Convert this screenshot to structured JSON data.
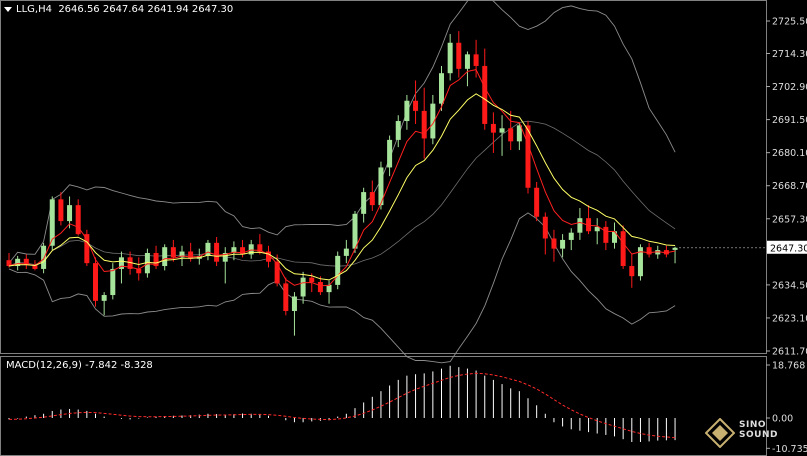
{
  "header": {
    "symbol": "LLG,H4",
    "ohlc": "2646.56 2647.64 2641.94 2647.30"
  },
  "macd": {
    "label": "MACD(12,26,9)",
    "values": "-7.842 -8.328",
    "axis_labels": [
      "18.768",
      "0.00",
      "-10.735"
    ]
  },
  "price_axis_labels": [
    "2725.50",
    "2714.30",
    "2702.90",
    "2691.50",
    "2680.10",
    "2668.70",
    "2657.30",
    "2634.50",
    "2623.10",
    "2611.70"
  ],
  "current_price": "2647.30",
  "logo_text": "SINO SOUND",
  "colors": {
    "background": "#000000",
    "up_candle": "#a6e39b",
    "down_candle": "#ff1a1a",
    "fast_ma": "#ff2020",
    "slow_ma": "#ffff66",
    "bollinger": "#8c8c8c",
    "macd_hist": "#ffffff",
    "macd_signal": "#ff2a2a"
  },
  "chart_data": {
    "type": "candlestick",
    "symbol": "LLG",
    "timeframe": "H4",
    "y_range": [
      2608,
      2730
    ],
    "candles": [
      [
        2643.0,
        2645.5,
        2640.5,
        2641.0
      ],
      [
        2641.0,
        2644.5,
        2639.5,
        2643.5
      ],
      [
        2643.5,
        2645.0,
        2640.0,
        2641.5
      ],
      [
        2641.5,
        2643.0,
        2639.5,
        2640.0
      ],
      [
        2640.0,
        2649.0,
        2638.5,
        2648.0
      ],
      [
        2648.0,
        2665.0,
        2646.5,
        2664.0
      ],
      [
        2664.0,
        2666.5,
        2655.0,
        2656.5
      ],
      [
        2656.5,
        2665.0,
        2654.0,
        2662.0
      ],
      [
        2662.0,
        2664.0,
        2651.5,
        2652.0
      ],
      [
        2652.0,
        2653.5,
        2641.0,
        2642.0
      ],
      [
        2642.0,
        2644.0,
        2627.0,
        2629.0
      ],
      [
        2629.0,
        2632.0,
        2624.0,
        2631.0
      ],
      [
        2631.0,
        2642.0,
        2629.5,
        2640.0
      ],
      [
        2640.0,
        2646.0,
        2635.0,
        2644.0
      ],
      [
        2644.0,
        2646.0,
        2638.0,
        2640.0
      ],
      [
        2640.0,
        2644.0,
        2636.0,
        2638.5
      ],
      [
        2638.5,
        2647.0,
        2637.0,
        2645.5
      ],
      [
        2645.5,
        2648.0,
        2640.0,
        2641.0
      ],
      [
        2641.0,
        2648.5,
        2639.5,
        2647.5
      ],
      [
        2647.5,
        2650.0,
        2642.5,
        2644.0
      ],
      [
        2644.0,
        2648.0,
        2641.0,
        2646.0
      ],
      [
        2646.0,
        2649.0,
        2642.5,
        2643.5
      ],
      [
        2643.5,
        2647.0,
        2641.5,
        2644.5
      ],
      [
        2644.5,
        2650.0,
        2643.0,
        2649.0
      ],
      [
        2649.0,
        2651.0,
        2641.0,
        2642.5
      ],
      [
        2642.5,
        2647.5,
        2635.0,
        2645.5
      ],
      [
        2645.5,
        2649.5,
        2643.0,
        2647.5
      ],
      [
        2647.5,
        2650.0,
        2644.0,
        2645.0
      ],
      [
        2645.0,
        2650.0,
        2643.5,
        2648.5
      ],
      [
        2648.5,
        2652.0,
        2645.0,
        2646.0
      ],
      [
        2646.0,
        2648.0,
        2640.5,
        2642.5
      ],
      [
        2642.5,
        2645.0,
        2634.0,
        2635.0
      ],
      [
        2635.0,
        2637.0,
        2624.0,
        2625.5
      ],
      [
        2625.5,
        2632.0,
        2617.0,
        2630.5
      ],
      [
        2630.5,
        2639.0,
        2628.0,
        2637.0
      ],
      [
        2637.0,
        2638.5,
        2632.0,
        2635.5
      ],
      [
        2635.5,
        2637.5,
        2631.0,
        2632.0
      ],
      [
        2632.0,
        2636.0,
        2628.0,
        2634.5
      ],
      [
        2634.5,
        2646.0,
        2633.0,
        2644.5
      ],
      [
        2644.5,
        2650.0,
        2642.0,
        2647.0
      ],
      [
        2647.0,
        2660.0,
        2645.5,
        2659.0
      ],
      [
        2659.0,
        2668.0,
        2656.0,
        2666.5
      ],
      [
        2666.5,
        2670.5,
        2660.0,
        2662.0
      ],
      [
        2662.0,
        2677.0,
        2660.5,
        2675.0
      ],
      [
        2675.0,
        2686.0,
        2672.0,
        2684.5
      ],
      [
        2684.5,
        2693.0,
        2682.0,
        2691.0
      ],
      [
        2691.0,
        2700.0,
        2688.0,
        2698.0
      ],
      [
        2698.0,
        2705.0,
        2690.0,
        2694.5
      ],
      [
        2694.5,
        2702.5,
        2678.0,
        2685.0
      ],
      [
        2685.0,
        2700.0,
        2683.0,
        2697.0
      ],
      [
        2697.0,
        2710.0,
        2694.5,
        2707.5
      ],
      [
        2707.5,
        2721.0,
        2705.0,
        2718.0
      ],
      [
        2718.0,
        2722.0,
        2706.0,
        2709.0
      ],
      [
        2709.0,
        2715.0,
        2703.0,
        2714.0
      ],
      [
        2714.0,
        2719.0,
        2706.0,
        2710.0
      ],
      [
        2710.0,
        2716.0,
        2688.0,
        2690.0
      ],
      [
        2690.0,
        2694.0,
        2680.0,
        2687.0
      ],
      [
        2687.0,
        2693.0,
        2679.0,
        2688.5
      ],
      [
        2688.5,
        2694.5,
        2681.0,
        2684.0
      ],
      [
        2684.0,
        2690.5,
        2681.0,
        2689.5
      ],
      [
        2689.5,
        2691.0,
        2666.0,
        2668.0
      ],
      [
        2668.0,
        2670.0,
        2656.5,
        2658.0
      ],
      [
        2658.0,
        2659.5,
        2645.0,
        2650.5
      ],
      [
        2650.5,
        2653.5,
        2642.5,
        2647.0
      ],
      [
        2647.0,
        2652.0,
        2644.0,
        2650.0
      ],
      [
        2650.0,
        2654.0,
        2646.5,
        2652.5
      ],
      [
        2652.5,
        2661.0,
        2650.0,
        2657.5
      ],
      [
        2657.5,
        2662.0,
        2652.0,
        2653.0
      ],
      [
        2653.0,
        2657.5,
        2648.5,
        2654.5
      ],
      [
        2654.5,
        2656.5,
        2646.5,
        2649.0
      ],
      [
        2649.0,
        2656.0,
        2647.0,
        2653.0
      ],
      [
        2653.0,
        2655.0,
        2640.0,
        2641.0
      ],
      [
        2641.0,
        2645.0,
        2633.5,
        2637.5
      ],
      [
        2637.5,
        2648.5,
        2636.0,
        2647.5
      ],
      [
        2647.5,
        2649.0,
        2644.0,
        2645.0
      ],
      [
        2645.0,
        2648.0,
        2643.5,
        2646.5
      ],
      [
        2646.5,
        2648.0,
        2644.0,
        2645.0
      ],
      [
        2646.56,
        2647.64,
        2641.94,
        2647.3
      ]
    ],
    "macd_histogram": [
      -0.5,
      -0.2,
      0.5,
      1.0,
      1.5,
      2.5,
      3.0,
      3.2,
      3.0,
      2.5,
      1.5,
      0.5,
      0.0,
      -0.3,
      -0.5,
      -0.2,
      0.2,
      0.5,
      0.7,
      0.8,
      0.9,
      1.0,
      1.2,
      1.5,
      1.4,
      1.2,
      1.4,
      1.6,
      1.5,
      1.3,
      0.8,
      0.0,
      -0.8,
      -1.5,
      -1.5,
      -1.2,
      -1.0,
      -0.8,
      0.5,
      1.5,
      3.5,
      5.5,
      7.5,
      9.5,
      11.5,
      13.5,
      15.0,
      15.5,
      15.8,
      16.5,
      17.5,
      18.5,
      18.0,
      17.5,
      16.8,
      15.0,
      13.5,
      12.0,
      10.5,
      9.5,
      7.0,
      4.5,
      1.5,
      -1.5,
      -3.0,
      -4.0,
      -4.5,
      -5.0,
      -5.5,
      -6.0,
      -6.5,
      -7.5,
      -8.5,
      -8.5,
      -8.3,
      -8.0,
      -7.9,
      -7.842
    ],
    "macd_params": "12,26,9"
  }
}
